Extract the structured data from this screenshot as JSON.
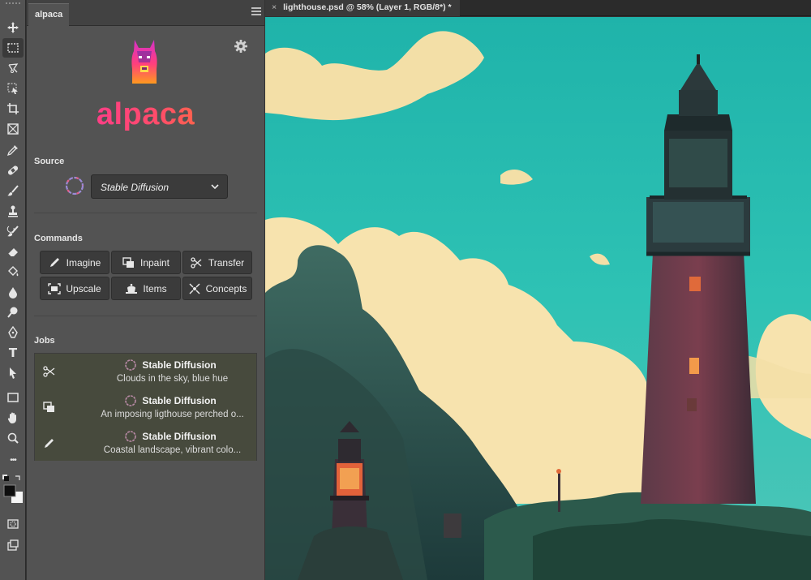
{
  "document": {
    "tab_title": "lighthouse.psd @ 58% (Layer 1, RGB/8*) *",
    "close_glyph": "×"
  },
  "toolbar": {
    "tools": [
      "move-tool",
      "marquee-tool",
      "lasso-tool",
      "object-select-tool",
      "crop-tool",
      "frame-tool",
      "eyedropper-tool",
      "healing-tool",
      "brush-tool",
      "stamp-tool",
      "history-brush-tool",
      "eraser-tool",
      "bucket-tool",
      "blur-tool",
      "dodge-tool",
      "pen-tool",
      "type-tool",
      "path-select-tool",
      "rectangle-tool",
      "hand-tool",
      "zoom-tool",
      "more-tools",
      "color-swatches",
      "quick-mask",
      "screen-mode"
    ],
    "type_glyph": "T",
    "more_glyph": "•••"
  },
  "panel": {
    "tab_label": "alpaca",
    "brand_name": "alpaca",
    "brand_colors": [
      "#ff2fa5",
      "#ff8a1c"
    ],
    "source": {
      "label": "Source",
      "selected": "Stable Diffusion"
    },
    "commands": {
      "label": "Commands",
      "items": [
        {
          "label": "Imagine",
          "icon": "pencil-icon"
        },
        {
          "label": "Inpaint",
          "icon": "layers-icon"
        },
        {
          "label": "Transfer",
          "icon": "transfer-icon"
        },
        {
          "label": "Upscale",
          "icon": "upscale-icon"
        },
        {
          "label": "Items",
          "icon": "items-icon"
        },
        {
          "label": "Concepts",
          "icon": "concepts-icon"
        }
      ]
    },
    "jobs": {
      "label": "Jobs",
      "items": [
        {
          "title": "Stable Diffusion",
          "description": "Clouds in the sky, blue hue",
          "icon": "transfer-icon"
        },
        {
          "title": "Stable Diffusion",
          "description": "An imposing ligthouse perched o...",
          "icon": "layers-icon"
        },
        {
          "title": "Stable Diffusion",
          "description": "Coastal landscape, vibrant colo...",
          "icon": "pencil-icon"
        }
      ]
    }
  }
}
